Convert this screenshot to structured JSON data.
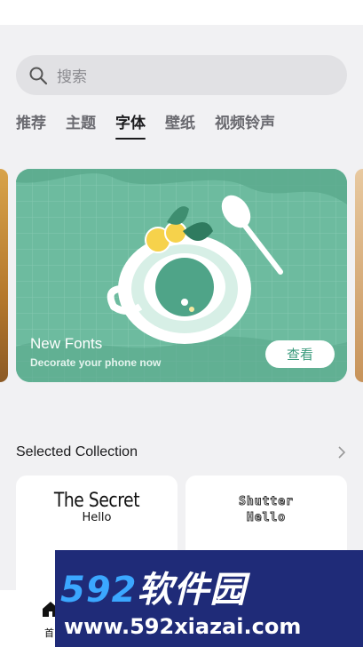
{
  "search": {
    "placeholder": "搜索"
  },
  "tabs": [
    {
      "label": "推荐"
    },
    {
      "label": "主题"
    },
    {
      "label": "字体"
    },
    {
      "label": "壁纸"
    },
    {
      "label": "视频铃声"
    }
  ],
  "active_tab": "字体",
  "banner": {
    "title": "New Fonts",
    "subtitle": "Decorate your phone now",
    "button_label": "查看"
  },
  "collection": {
    "title": "Selected Collection",
    "cards": [
      {
        "sample_title": "The Secret",
        "sample_sub": "Hello"
      },
      {
        "sample_title": "Shutter",
        "sample_sub": "Hello"
      }
    ]
  },
  "bottom_nav": {
    "home_label": "首"
  },
  "watermark": {
    "brand_num": "592",
    "brand_text": "软件园",
    "url": "www.592xiazai.com"
  },
  "colors": {
    "accent": "#3a9a7c",
    "banner_bg": "#6fbea3",
    "watermark_bg": "#1f2b78"
  },
  "icons": {
    "search": "search-icon",
    "chevron": "chevron-right-icon",
    "home": "home-icon"
  }
}
